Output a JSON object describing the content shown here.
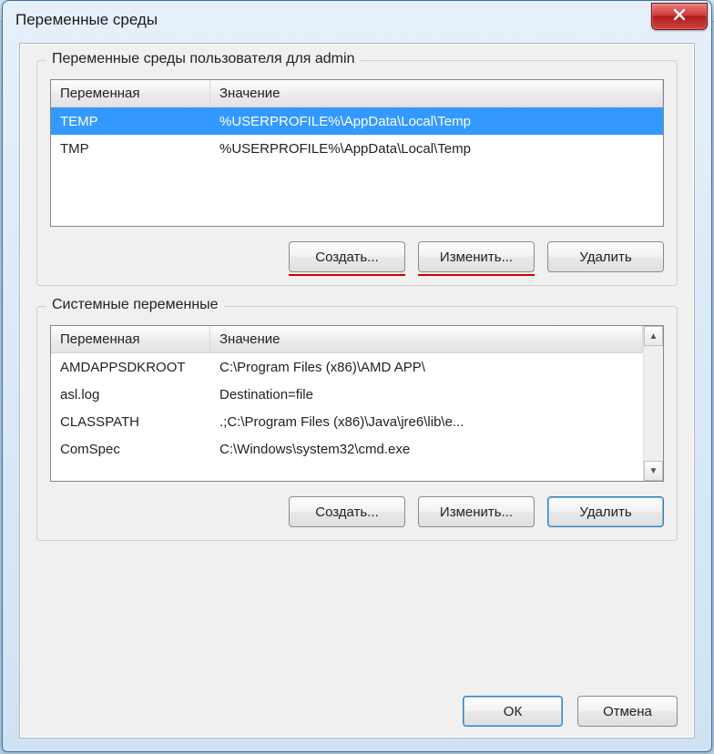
{
  "window": {
    "title": "Переменные среды",
    "close_icon": "close-x"
  },
  "user_group": {
    "label": "Переменные среды пользователя для admin",
    "columns": {
      "name": "Переменная",
      "value": "Значение"
    },
    "rows": [
      {
        "name": "TEMP",
        "value": "%USERPROFILE%\\AppData\\Local\\Temp",
        "selected": true
      },
      {
        "name": "TMP",
        "value": "%USERPROFILE%\\AppData\\Local\\Temp",
        "selected": false
      }
    ],
    "buttons": {
      "new": "Создать...",
      "edit": "Изменить...",
      "delete": "Удалить"
    }
  },
  "system_group": {
    "label": "Системные переменные",
    "columns": {
      "name": "Переменная",
      "value": "Значение"
    },
    "rows": [
      {
        "name": "AMDAPPSDKROOT",
        "value": "C:\\Program Files (x86)\\AMD APP\\"
      },
      {
        "name": "asl.log",
        "value": "Destination=file"
      },
      {
        "name": "CLASSPATH",
        "value": ".;C:\\Program Files (x86)\\Java\\jre6\\lib\\e..."
      },
      {
        "name": "ComSpec",
        "value": "C:\\Windows\\system32\\cmd.exe"
      }
    ],
    "buttons": {
      "new": "Создать...",
      "edit": "Изменить...",
      "delete": "Удалить"
    }
  },
  "footer": {
    "ok": "ОК",
    "cancel": "Отмена"
  }
}
